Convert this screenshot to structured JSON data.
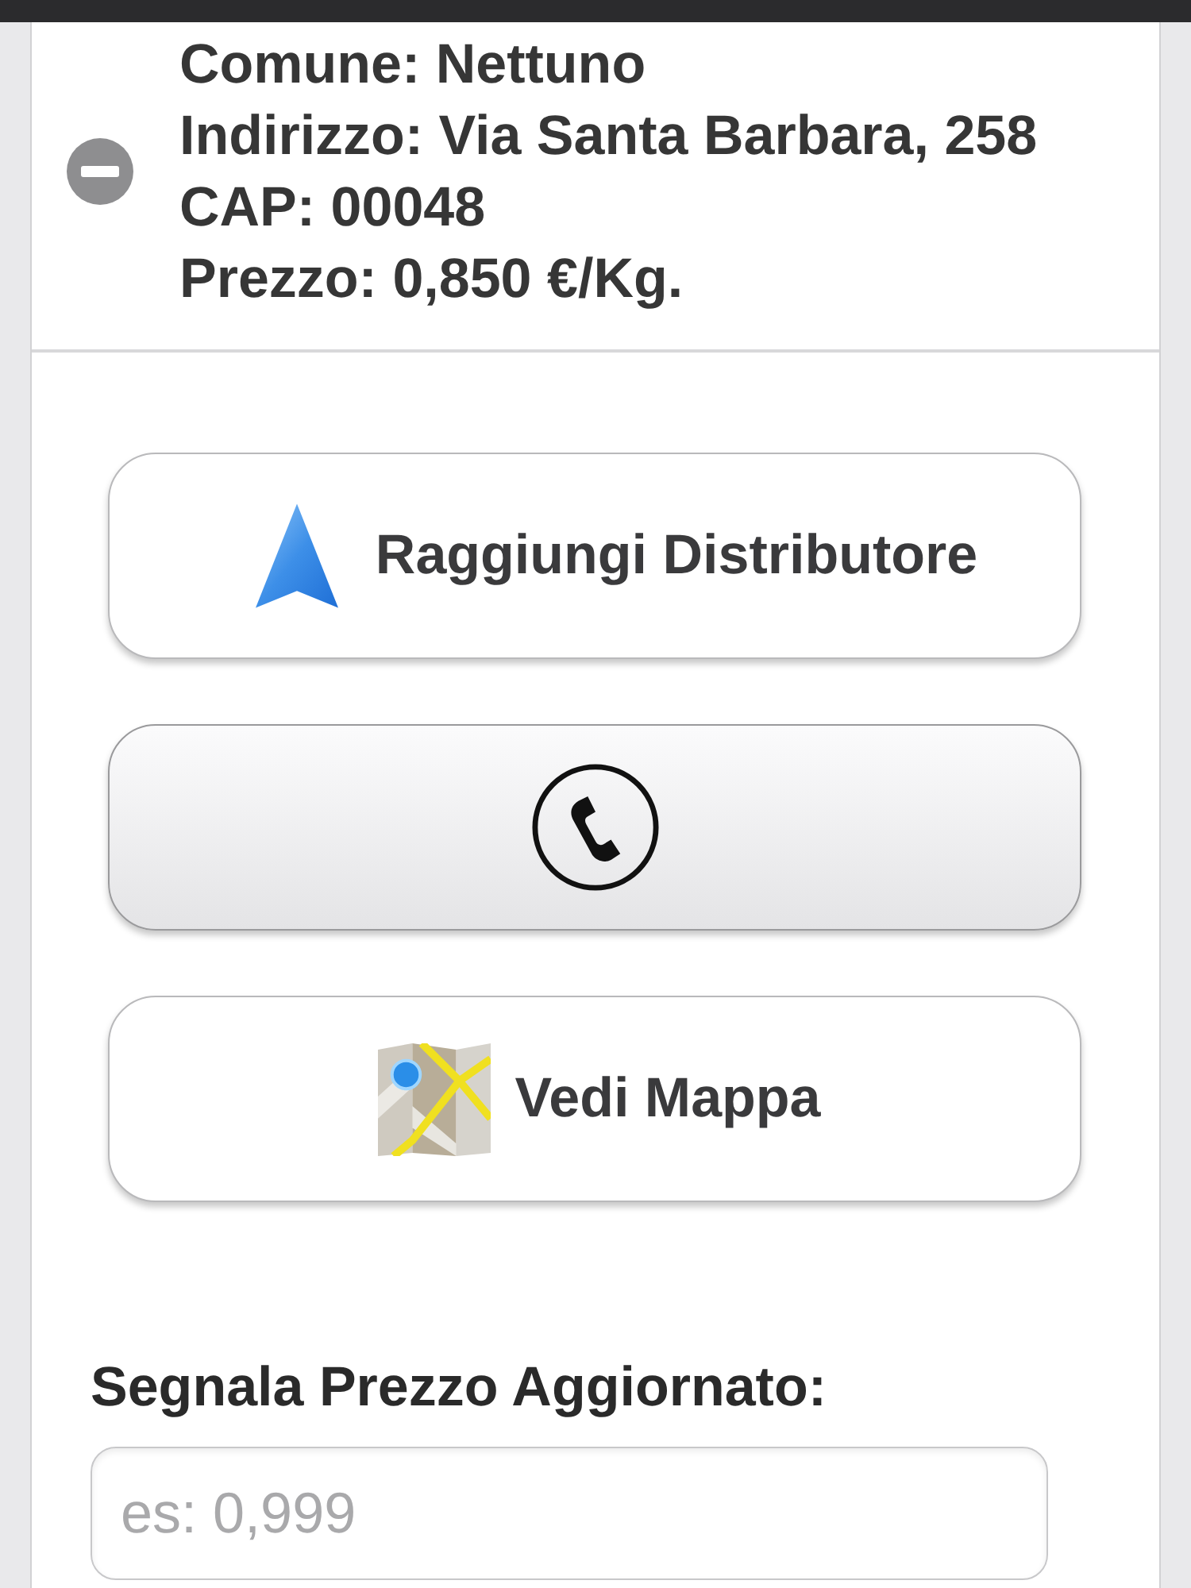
{
  "details": {
    "expanded": true,
    "lines": [
      "Comune: Nettuno",
      "Indirizzo: Via Santa Barbara, 258",
      "CAP: 00048",
      "Prezzo: 0,850 €/Kg."
    ]
  },
  "actions": [
    {
      "kind": "navigate",
      "label": "Raggiungi Distributore",
      "pressed": false
    },
    {
      "kind": "call",
      "pressed": true
    },
    {
      "kind": "map",
      "label": "Vedi Mappa",
      "pressed": false
    }
  ],
  "price_report": {
    "label": "Segnala Prezzo Aggiornato:",
    "placeholder": "es: 0,999"
  }
}
